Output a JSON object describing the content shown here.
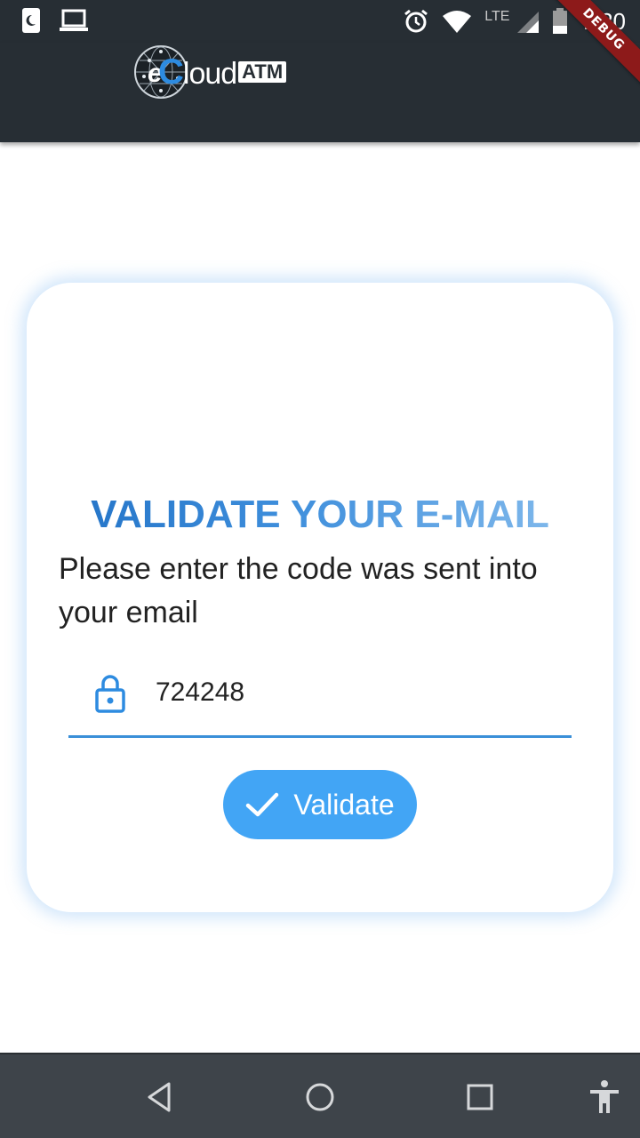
{
  "status_bar": {
    "time": "7:20",
    "network_label": "LTE",
    "icons": [
      "moon-icon",
      "laptop-icon",
      "alarm-icon",
      "wifi-icon",
      "signal-icon",
      "battery-icon"
    ]
  },
  "debug_banner": {
    "label": "DEBUG",
    "color": "#8d1a1a"
  },
  "app_bar": {
    "logo": {
      "prefix": "e",
      "cloud_text": "Cloud",
      "badge_text": "ATM"
    },
    "background": "#272e34"
  },
  "card": {
    "title": "VALIDATE YOUR E-MAIL",
    "subtitle": "Please enter the code was sent into your email",
    "code_field": {
      "value": "724248",
      "icon": "lock-icon"
    },
    "validate_button": {
      "label": "Validate",
      "icon": "check-icon"
    },
    "accent_color": "#42a5f5"
  },
  "nav_bar": {
    "buttons": [
      "back-icon",
      "home-icon",
      "recents-icon",
      "accessibility-icon"
    ]
  }
}
